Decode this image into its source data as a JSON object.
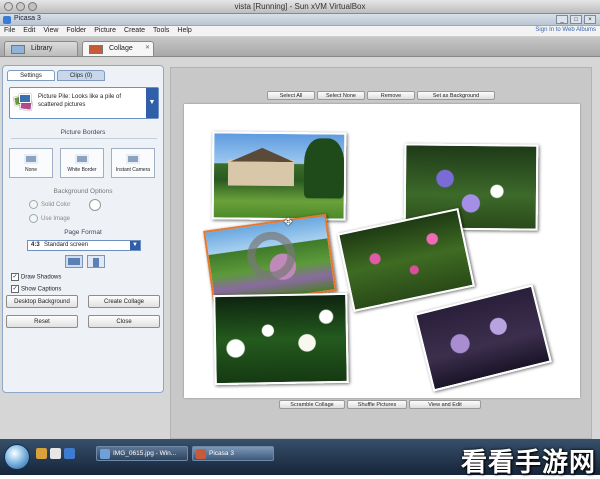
{
  "mac_window": {
    "title": "vista [Running] - Sun xVM VirtualBox"
  },
  "app_window": {
    "title": "Picasa 3",
    "controls": [
      "_",
      "□",
      "×"
    ]
  },
  "menu": {
    "items": [
      "File",
      "Edit",
      "View",
      "Folder",
      "Picture",
      "Create",
      "Tools",
      "Help"
    ],
    "sign_in": "Sign In to Web Albums"
  },
  "tabs": [
    {
      "label": "Library",
      "active": false
    },
    {
      "label": "Collage",
      "active": true
    }
  ],
  "panel": {
    "tabs": [
      "Settings",
      "Clips (0)"
    ],
    "collage_type": {
      "label": "Picture Pile:  Looks like a pile of scattered pictures"
    },
    "borders": {
      "heading": "Picture Borders",
      "options": [
        "None",
        "White Border",
        "Instant Camera"
      ]
    },
    "background": {
      "heading": "Background Options",
      "solid_color": "Solid Color",
      "use_image": "Use Image"
    },
    "page_format": {
      "heading": "Page Format",
      "ratio": "4:3",
      "label": "Standard screen"
    },
    "checkboxes": [
      {
        "label": "Draw Shadows",
        "checked": true
      },
      {
        "label": "Show Captions",
        "checked": true
      }
    ],
    "buttons": {
      "desktop_background": "Desktop Background",
      "create_collage": "Create Collage",
      "reset": "Reset",
      "close": "Close"
    }
  },
  "toolbar_top": [
    "Select All",
    "Select None",
    "Remove",
    "Set as Background"
  ],
  "toolbar_bottom": [
    "Scramble Collage",
    "Shuffle Pictures",
    "View and Edit"
  ],
  "taskbar": {
    "items": [
      {
        "label": "IMG_0615.jpg - Win..."
      },
      {
        "label": "Picasa 3"
      }
    ]
  },
  "watermark": "看看手游网",
  "colors": {
    "accent": "#2e5fa8",
    "selected_photo_border": "#e8772e"
  }
}
